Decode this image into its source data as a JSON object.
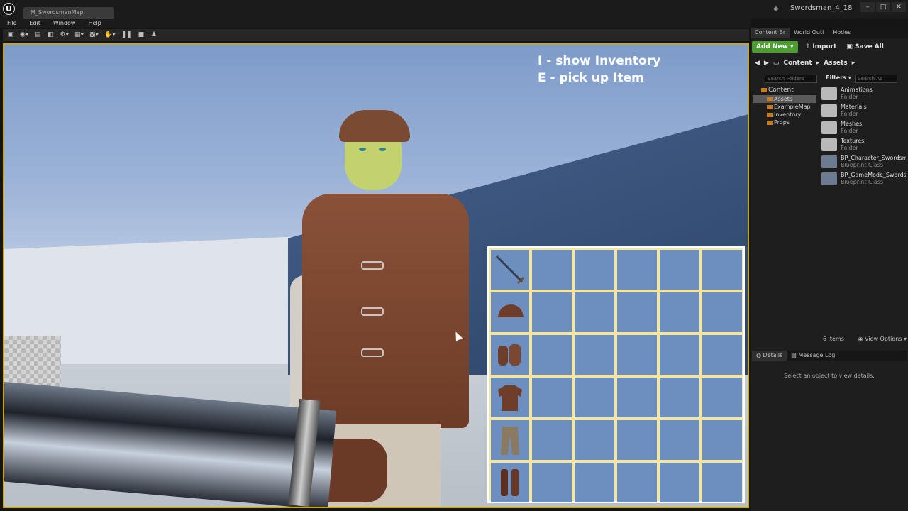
{
  "window": {
    "map_tab": "M_SwordsmanMap",
    "project_name": "Swordsman_4_18",
    "minimize": "–",
    "maximize": "□",
    "close": "✕"
  },
  "menu": [
    "File",
    "Edit",
    "Window",
    "Help"
  ],
  "viewport": {
    "hint_line1": "I - show Inventory",
    "hint_line2": "E - pick up Item"
  },
  "inventory": {
    "equipment_slots": [
      "sword-icon",
      "helmet-icon",
      "gloves-icon",
      "armor-icon",
      "pants-icon",
      "boots-icon"
    ],
    "grid_columns": 5,
    "grid_rows": 6,
    "slot_color": "#6d8fc0",
    "border_color": "#f4e6a2"
  },
  "right_panel": {
    "tabs": [
      "Content Br",
      "World Outl",
      "Modes"
    ],
    "add_new": "Add New",
    "import": "Import",
    "save_all": "Save All",
    "breadcrumb": [
      "Content",
      "Assets"
    ],
    "search_folders": "Search Folders",
    "filters": "Filters",
    "search_assets": "Search As",
    "tree_root": "Content",
    "tree_items": [
      "Assets",
      "ExampleMap",
      "Inventory",
      "Props"
    ],
    "assets": [
      {
        "name": "Animations",
        "type": "Folder"
      },
      {
        "name": "Materials",
        "type": "Folder"
      },
      {
        "name": "Meshes",
        "type": "Folder"
      },
      {
        "name": "Textures",
        "type": "Folder"
      },
      {
        "name": "BP_Character_Swordsma",
        "type": "Blueprint Class"
      },
      {
        "name": "BP_GameMode_Swordsr",
        "type": "Blueprint Class"
      }
    ],
    "item_count": "6 items",
    "view_options": "View Options",
    "lower_tabs": [
      "Details",
      "Message Log"
    ],
    "details_message": "Select an object to view details."
  }
}
